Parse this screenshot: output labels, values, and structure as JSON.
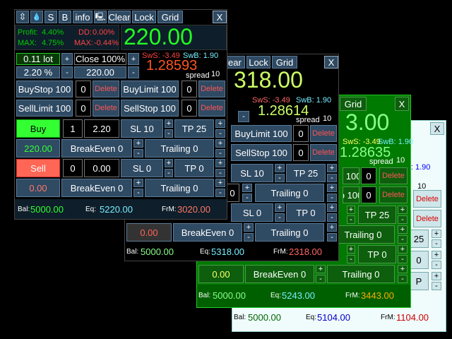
{
  "toolbar": {
    "btn1": "⇳",
    "btn2": "💧",
    "btn3": "S",
    "btn4": "B",
    "btn5": "info",
    "btn6": "🖳",
    "btn7": "Clear",
    "btn8": "Lock",
    "btn9": "Grid",
    "close": "X"
  },
  "main": {
    "profit_label": "Profit:",
    "profit_val": "4.40%",
    "dd_label": "DD:",
    "dd_val": "0.00%",
    "max_label": "MAX:",
    "max_val": "4.75%",
    "maxneg_label": "MAX:",
    "maxneg_val": "-0.44%",
    "big_price": "220.00",
    "lot": "0.11 lot",
    "plus": "+",
    "minus": "-",
    "close_pct": "Close 100%",
    "pct": "2.20 %",
    "pct_val": "220.00",
    "sws": "SwS: -3.49",
    "swb": "SwB: 1.90",
    "bid": "1.28593",
    "spread_label": "spread",
    "spread_val": "10",
    "buystop": "BuyStop 100",
    "buystop_n": "0",
    "delete": "Delete",
    "buylimit": "BuyLimit 100",
    "buylimit_n": "0",
    "selllimit": "SellLimit 100",
    "selllimit_n": "0",
    "sellstop": "SellStop 100",
    "sellstop_n": "0",
    "buy": "Buy",
    "buy_n": "1",
    "buy_lot": "2.20",
    "buy_sl": "SL 10",
    "buy_tp": "TP 25",
    "buy_profit": "220.00",
    "breakeven": "BreakEven 0",
    "trailing": "Trailing  0",
    "sell": "Sell",
    "sell_n": "0",
    "sell_lot": "0.00",
    "sell_sl": "SL 0",
    "sell_tp": "TP 0",
    "sell_profit": "0.00",
    "breakeven2": "BreakEven 0",
    "trailing2": "Trailing  0",
    "bal_label": "Bal:",
    "bal_val": "5000.00",
    "eq_label": "Eq:",
    "eq_val": "5220.00",
    "frm_label": "FrM:",
    "frm_val": "3020.00"
  },
  "second": {
    "clear": "lear",
    "lock": "Lock",
    "grid": "Grid",
    "close": "X",
    "big": "318.00",
    "sws": "SwS: -3.49",
    "swb": "SwB: 1.90",
    "bid": "1.28614",
    "spread_label": "spread",
    "spread_val": "10",
    "buylimit": "BuyLimit 100",
    "buylimit_n": "0",
    "sellstop": "SellStop 100",
    "sellstop_n": "0",
    "delete": "Delete",
    "sl": "SL 10",
    "tp": "TP 25",
    "trailing": "Trailing  0",
    "sl2": "SL 0",
    "tp2": "TP 0",
    "val0": "0",
    "profit": "0.00",
    "breakeven": "BreakEven 0",
    "trailing2": "Trailing  0",
    "bal_label": "Bal:",
    "bal_val": "5000.00",
    "eq_label": "Eq:",
    "eq_val": "5318.00",
    "frm_label": "FrM:",
    "frm_val": "2318.00"
  },
  "third": {
    "grid": "Grid",
    "close": "X",
    "big": "3.00",
    "sws": "SwS: -3.49",
    "swb": "SwB: 1.90",
    "bid": "1.28635",
    "spread_label": "spread",
    "spread_val": "10",
    "row1": "t 100",
    "row1_n": "0",
    "row2": "o 100",
    "row2_n": "0",
    "delete": "Delete",
    "tp": "TP 25",
    "trailing": "Trailing  0",
    "tp2": "TP 0",
    "profit": "0.00",
    "breakeven": "BreakEven 0",
    "trailing2": "Trailing  0",
    "bal_label": "Bal:",
    "bal_val": "5000.00",
    "eq_label": "Eq:",
    "eq_val": "5243.00",
    "frm_label": "FrM:",
    "frm_val": "3443.00"
  },
  "fourth": {
    "close": "X",
    "swb": "vB: 1.90",
    "big_frag": "7",
    "spread_val": "10",
    "delete": "Delete",
    "tp": "25",
    "tp2": "0",
    "p": "P",
    "bal_label": "Bal:",
    "bal_val": "5000.00",
    "eq_label": "Eq:",
    "eq_val": "5104.00",
    "frm_label": "FrM:",
    "frm_val": "1104.00"
  }
}
